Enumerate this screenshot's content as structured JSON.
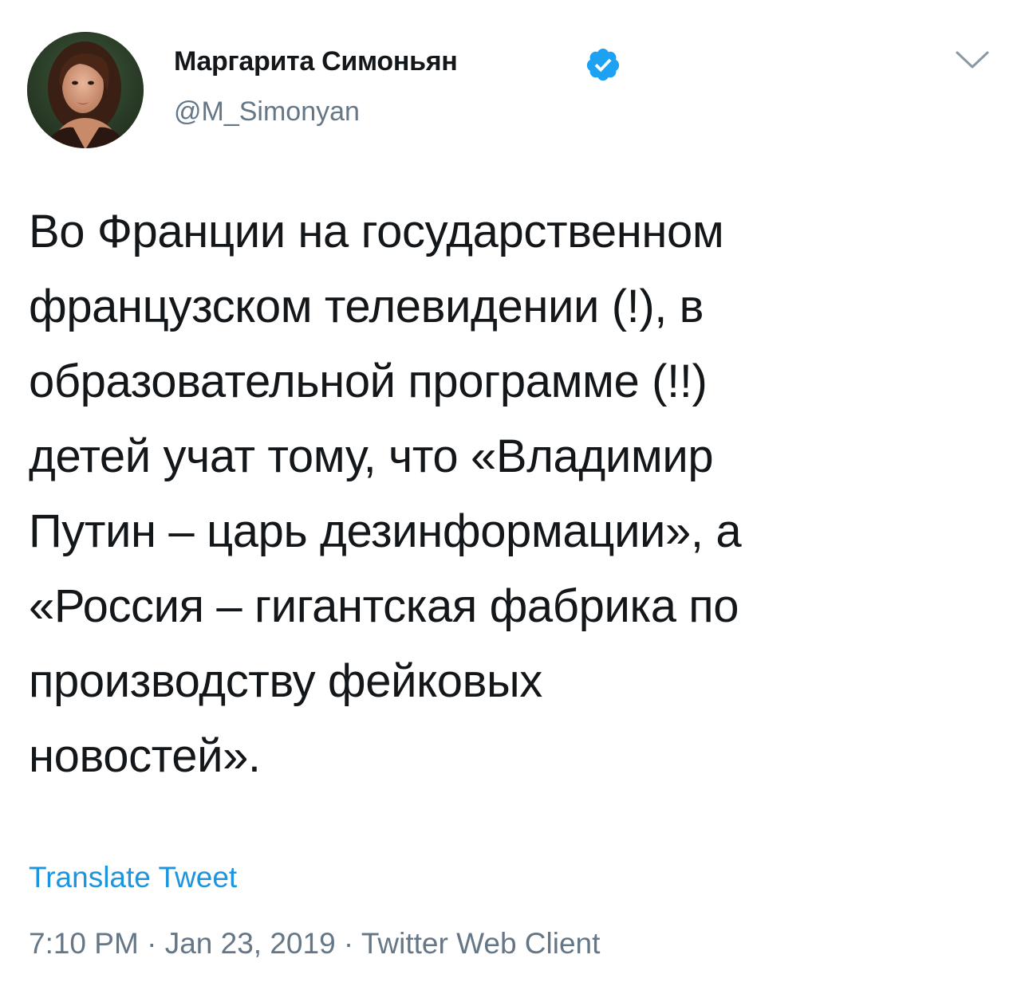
{
  "author": {
    "name": "Маргарита Симоньян",
    "handle": "@M_Simonyan",
    "verified": true
  },
  "tweet": {
    "lines": [
      "Во Франции на государственном",
      "французском телевидении (!), в",
      "образовательной программе (!!)",
      "детей учат тому, что «Владимир",
      "Путин – царь дезинформации», а",
      "«Россия – гигантская фабрика по",
      "производству фейковых",
      "новостей»."
    ]
  },
  "translate_label": "Translate Tweet",
  "meta": {
    "time": "7:10 PM",
    "separator": " · ",
    "date": "Jan 23, 2019",
    "client": "Twitter Web Client"
  },
  "icons": {
    "verified": "verified-badge-icon",
    "menu": "chevron-down-icon"
  },
  "colors": {
    "text": "#14171a",
    "secondary": "#657786",
    "link": "#1b95e0",
    "verified": "#1da1f2"
  }
}
